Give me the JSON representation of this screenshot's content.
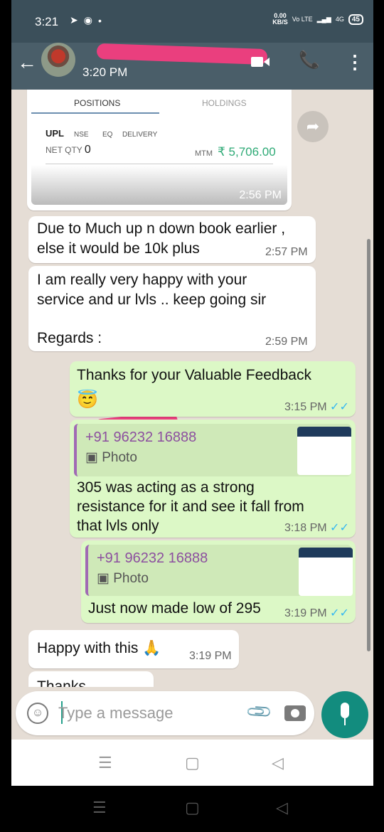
{
  "status_bar": {
    "time": "3:21",
    "speed_value": "0.00",
    "speed_unit": "KB/S",
    "network": "Vo LTE",
    "signal": "4G",
    "battery": "45"
  },
  "header": {
    "last_seen": "3:20 PM"
  },
  "messages": {
    "image": {
      "tab_positions": "POSITIONS",
      "tab_holdings": "HOLDINGS",
      "stock": "UPL",
      "tag_exchange": "NSE",
      "tag_segment": "EQ",
      "tag_type": "DELIVERY",
      "net_qty_label": "NET QTY",
      "net_qty_value": "0",
      "mtm_label": "MTM",
      "mtm_value": "₹ 5,706.00",
      "time": "2:56 PM"
    },
    "m1": {
      "text_line1": "Due to Much up n down book earlier ,",
      "text_line2": "else it would be 10k plus",
      "time": "2:57 PM"
    },
    "m2": {
      "text_line1": "I am really very happy with your",
      "text_line2": "service and ur lvls .. keep going sir",
      "text_line3": "Regards :",
      "time": "2:59 PM"
    },
    "m3": {
      "text": "Thanks for your Valuable Feedback",
      "emoji": "😇",
      "time": "3:15 PM"
    },
    "m4": {
      "quote_number": "+91 96232 16888",
      "quote_label": "Photo",
      "text_line1": "305 was acting as a strong",
      "text_line2": "resistance for it and see it fall from",
      "text_line3": "that lvls only",
      "time": "3:18 PM"
    },
    "m5": {
      "quote_number": "+91 96232 16888",
      "quote_label": "Photo",
      "text": "Just now made low of 295",
      "time": "3:19 PM"
    },
    "m6": {
      "text": "Happy with this",
      "emoji": "🙏",
      "time": "3:19 PM"
    },
    "m7": {
      "text": "Thanks"
    }
  },
  "input": {
    "placeholder": "Type a message"
  },
  "colors": {
    "header": "#4a5e69",
    "outgoing_bubble": "#dcf8c6",
    "incoming_bubble": "#ffffff",
    "mic_button": "#128c7e",
    "read_ticks": "#34b7f1"
  }
}
